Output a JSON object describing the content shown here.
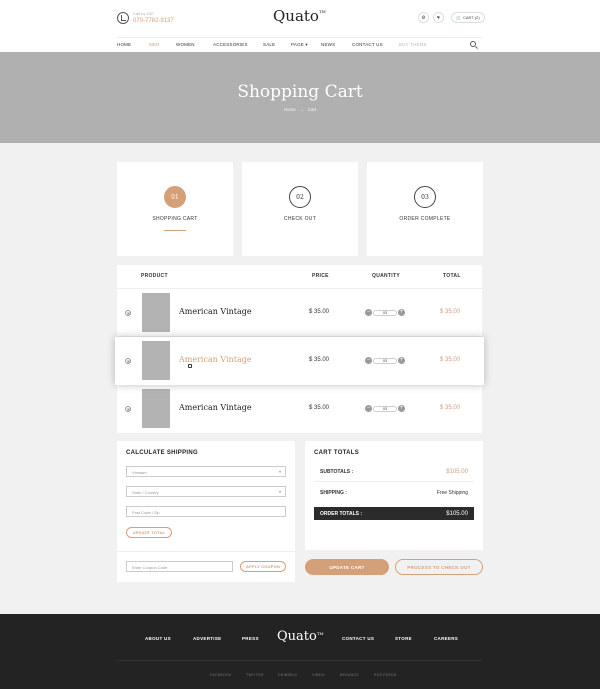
{
  "header": {
    "call_label": "Call us 24/7",
    "phone": "070-7782-9137",
    "logo": "Quato",
    "logo_tm": "TM",
    "cart_label": "CART (2)"
  },
  "nav": {
    "items": [
      "HOME",
      "MEN",
      "WOMEN",
      "ACCESSORIES",
      "SALE",
      "PAGE ▾",
      "NEWS",
      "CONTACT US",
      "BUY THEME"
    ]
  },
  "banner": {
    "title": "Shopping Cart",
    "crumb_home": "Home",
    "crumb_sep": "→",
    "crumb_current": "Cart"
  },
  "steps": [
    {
      "num": "01",
      "label": "SHOPPING CART"
    },
    {
      "num": "02",
      "label": "CHECK OUT"
    },
    {
      "num": "03",
      "label": "ORDER COMPLETE"
    }
  ],
  "cart": {
    "headers": {
      "product": "PRODUCT",
      "price": "PRICE",
      "quantity": "QUANTITY",
      "total": "TOTAL"
    },
    "rows": [
      {
        "name": "American Vintage",
        "price": "$ 35.00",
        "qty": "03",
        "total": "$ 35.00"
      },
      {
        "name": "American Vintage",
        "price": "$ 35.00",
        "qty": "03",
        "total": "$ 35.00"
      },
      {
        "name": "American Vintage",
        "price": "$ 35.00",
        "qty": "03",
        "total": "$ 35.00"
      }
    ]
  },
  "shipping": {
    "title": "CALCULATE SHIPPING",
    "country": "Vietnam",
    "state_placeholder": "State / Country",
    "postcode_placeholder": "Post Code / Zip",
    "update_total": "UPDATE TOTAL",
    "coupon_placeholder": "Enter Coupon Code",
    "apply_coupon": "APPLY COUPON"
  },
  "totals": {
    "title": "CART TOTALS",
    "subtotal_label": "SUBTOTALS :",
    "subtotal_value": "$105.00",
    "shipping_label": "SHIPPING :",
    "shipping_value": "Free Shipping",
    "order_total_label": "ORDER TOTALS :",
    "order_total_value": "$105.00"
  },
  "actions": {
    "update_cart": "UPDATE CART",
    "checkout": "PROCESS TO CHECK OUT"
  },
  "footer": {
    "links": [
      "ABOUT US",
      "ADVERTISE",
      "PRESS",
      "CONTACT US",
      "STORE",
      "CAREERS"
    ],
    "logo": "Quato",
    "logo_tm": "TM",
    "social": [
      "FACEBOOK",
      "TWITTER",
      "DRIBBBLE",
      "VIMEO",
      "BEHANCE",
      "RSS FEEDS"
    ]
  },
  "colors": {
    "accent": "#d5a078",
    "banner": "#b0b0b0",
    "footer": "#232323"
  }
}
